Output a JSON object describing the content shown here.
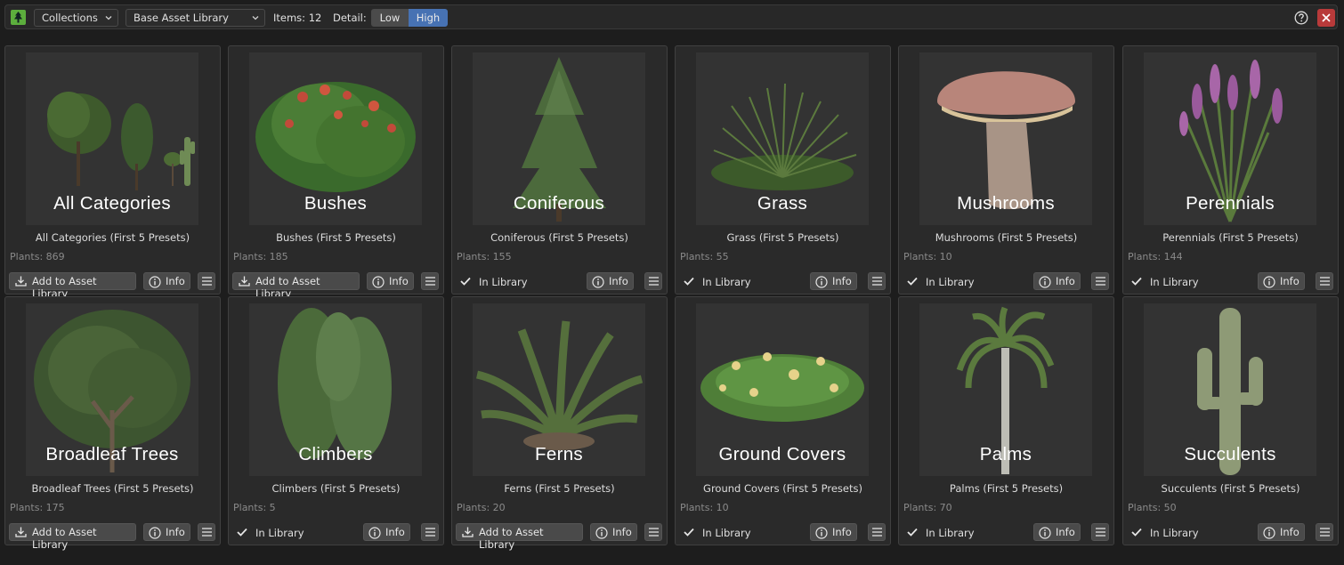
{
  "header": {
    "collections_select": "Collections",
    "library_select": "Base Asset Library",
    "items_label": "Items: 12",
    "detail_label": "Detail:",
    "detail_low": "Low",
    "detail_high": "High",
    "help_icon": "question-circle-icon",
    "close_icon": "close-icon"
  },
  "actions": {
    "add_label": "Add to Asset Library",
    "info_label": "Info",
    "in_library_label": "In Library"
  },
  "cards": [
    {
      "thumb": "All Categories",
      "title": "All Categories (First 5 Presets)",
      "count": "Plants: 869",
      "in_library": false
    },
    {
      "thumb": "Bushes",
      "title": "Bushes (First 5 Presets)",
      "count": "Plants: 185",
      "in_library": false
    },
    {
      "thumb": "Coniferous",
      "title": "Coniferous (First 5 Presets)",
      "count": "Plants: 155",
      "in_library": true
    },
    {
      "thumb": "Grass",
      "title": "Grass (First 5 Presets)",
      "count": "Plants: 55",
      "in_library": true
    },
    {
      "thumb": "Mushrooms",
      "title": "Mushrooms (First 5 Presets)",
      "count": "Plants: 10",
      "in_library": true
    },
    {
      "thumb": "Perennials",
      "title": "Perennials (First 5 Presets)",
      "count": "Plants: 144",
      "in_library": true
    },
    {
      "thumb": "Broadleaf Trees",
      "title": "Broadleaf Trees (First 5 Presets)",
      "count": "Plants: 175",
      "in_library": false
    },
    {
      "thumb": "Climbers",
      "title": "Climbers (First 5 Presets)",
      "count": "Plants: 5",
      "in_library": true
    },
    {
      "thumb": "Ferns",
      "title": "Ferns (First 5 Presets)",
      "count": "Plants: 20",
      "in_library": false
    },
    {
      "thumb": "Ground Covers",
      "title": "Ground Covers (First 5 Presets)",
      "count": "Plants: 10",
      "in_library": true
    },
    {
      "thumb": "Palms",
      "title": "Palms (First 5 Presets)",
      "count": "Plants: 70",
      "in_library": true
    },
    {
      "thumb": "Succulents",
      "title": "Succulents (First 5 Presets)",
      "count": "Plants: 50",
      "in_library": true
    }
  ],
  "colors": {
    "accent": "#4772b3",
    "close": "#b83a3a",
    "logo": "#5cae3d"
  }
}
